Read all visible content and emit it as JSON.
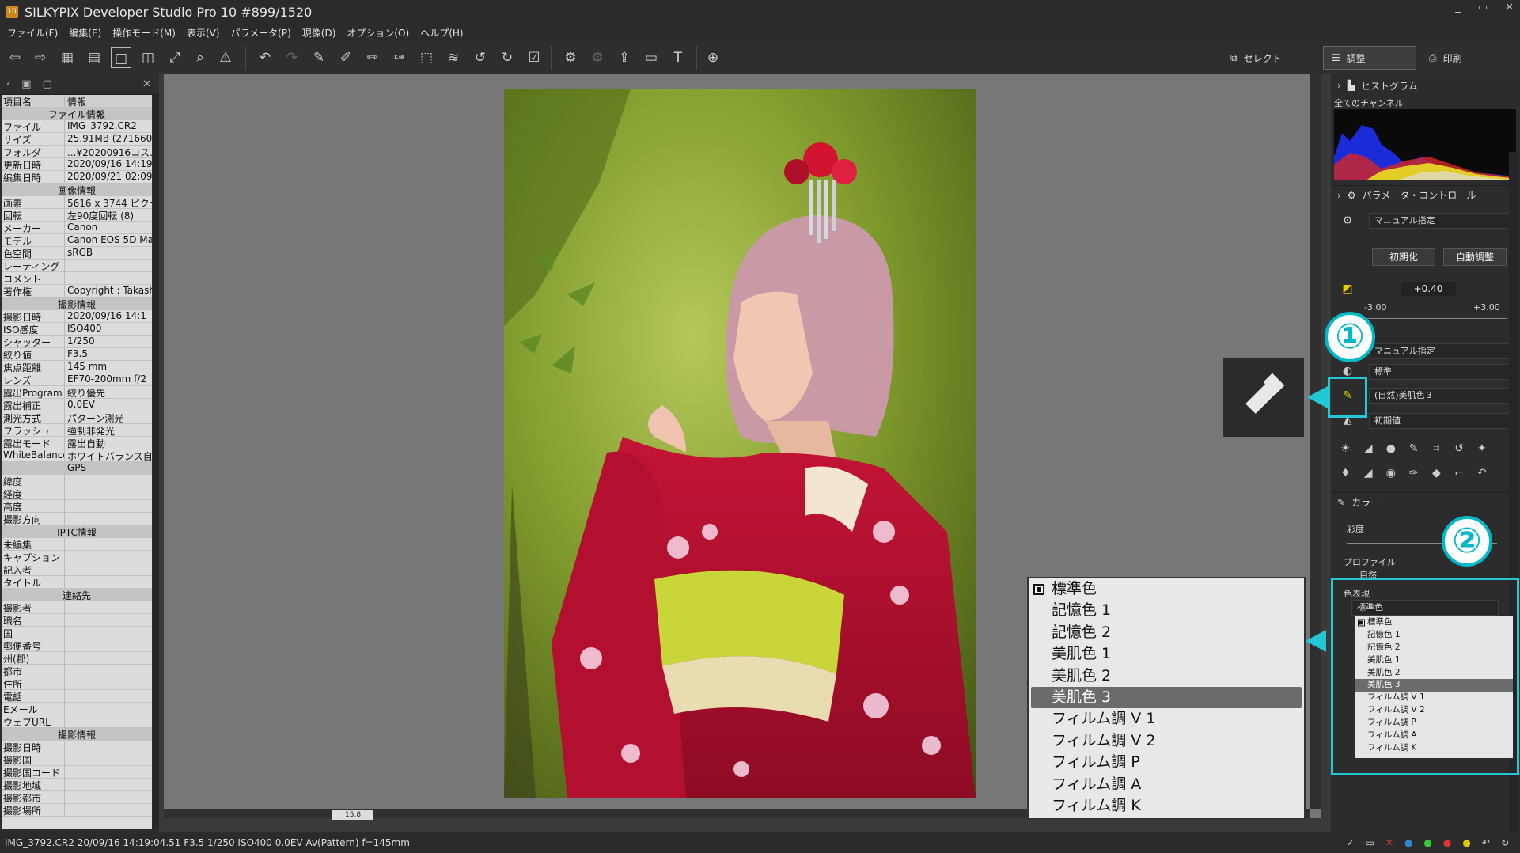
{
  "window": {
    "title": "SILKYPIX Developer Studio Pro 10   #899/1520",
    "app_icon": "10",
    "controls": [
      "_",
      "▭",
      "✕"
    ]
  },
  "menu": [
    "ファイル(F)",
    "編集(E)",
    "操作モード(M)",
    "表示(V)",
    "パラメータ(P)",
    "現像(D)",
    "オプション(O)",
    "ヘルプ(H)"
  ],
  "modes": {
    "select": "セレクト",
    "adjust": "調整",
    "print": "印刷"
  },
  "info_panel": {
    "col_item": "項目名",
    "col_info": "情報",
    "rows": [
      {
        "s": "ファイル情報"
      },
      {
        "k": "ファイル",
        "v": "IMG_3792.CR2"
      },
      {
        "k": "サイズ",
        "v": "25.91MB (2716606"
      },
      {
        "k": "フォルダ",
        "v": "...¥20200916コス..."
      },
      {
        "k": "更新日時",
        "v": "2020/09/16 14:19:"
      },
      {
        "k": "編集日時",
        "v": "2020/09/21 02:09:"
      },
      {
        "s": "画像情報"
      },
      {
        "k": "画素",
        "v": "5616 x 3744 ピクセ/"
      },
      {
        "k": "回転",
        "v": "左90度回転 (8)"
      },
      {
        "k": "メーカー",
        "v": "Canon"
      },
      {
        "k": "モデル",
        "v": "Canon EOS 5D Ma"
      },
      {
        "k": "色空間",
        "v": "sRGB"
      },
      {
        "k": "レーティング",
        "v": ""
      },
      {
        "k": "コメント",
        "v": ""
      },
      {
        "k": "著作権",
        "v": "Copyright : Takash"
      },
      {
        "s": "撮影情報"
      },
      {
        "k": "撮影日時",
        "v": "2020/09/16 14:1"
      },
      {
        "k": "ISO感度",
        "v": "ISO400"
      },
      {
        "k": "シャッター",
        "v": "1/250"
      },
      {
        "k": "絞り値",
        "v": "F3.5"
      },
      {
        "k": "焦点距離",
        "v": "145 mm"
      },
      {
        "k": "レンズ",
        "v": "EF70-200mm f/2"
      },
      {
        "k": "露出Program",
        "v": "絞り優先"
      },
      {
        "k": "露出補正",
        "v": "0.0EV"
      },
      {
        "k": "測光方式",
        "v": "パターン測光"
      },
      {
        "k": "フラッシュ",
        "v": "強制非発光"
      },
      {
        "k": "露出モード",
        "v": "露出自動"
      },
      {
        "k": "WhiteBalance",
        "v": "ホワイトバランス自動"
      },
      {
        "s": "GPS"
      },
      {
        "k": "緯度",
        "v": ""
      },
      {
        "k": "経度",
        "v": ""
      },
      {
        "k": "高度",
        "v": ""
      },
      {
        "k": "撮影方向",
        "v": ""
      },
      {
        "s": "IPTC情報"
      },
      {
        "k": "未編集",
        "v": ""
      },
      {
        "k": "キャプション",
        "v": ""
      },
      {
        "k": "記入者",
        "v": ""
      },
      {
        "k": "タイトル",
        "v": ""
      },
      {
        "s": "連絡先"
      },
      {
        "k": "撮影者",
        "v": ""
      },
      {
        "k": "職名",
        "v": ""
      },
      {
        "k": "国",
        "v": ""
      },
      {
        "k": "郵便番号",
        "v": ""
      },
      {
        "k": "州(郡)",
        "v": ""
      },
      {
        "k": "都市",
        "v": ""
      },
      {
        "k": "住所",
        "v": ""
      },
      {
        "k": "電話",
        "v": ""
      },
      {
        "k": "Eメール",
        "v": ""
      },
      {
        "k": "ウェブURL",
        "v": ""
      },
      {
        "s": "撮影情報"
      },
      {
        "k": "撮影日時",
        "v": ""
      },
      {
        "k": "撮影国",
        "v": ""
      },
      {
        "k": "撮影国コード",
        "v": ""
      },
      {
        "k": "撮影地域",
        "v": ""
      },
      {
        "k": "撮影都市",
        "v": ""
      },
      {
        "k": "撮影場所",
        "v": ""
      }
    ]
  },
  "viewer": {
    "zoom": "15.8",
    "zoom_unit": "%"
  },
  "right_panel": {
    "histogram": {
      "title": "ヒストグラム",
      "channel": "全てのチャンネル"
    },
    "param": {
      "title": "パラメータ・コントロール",
      "taste": "マニュアル指定",
      "init_btn": "初期化",
      "auto_btn": "自動調整",
      "exposure": "+0.40",
      "exp_min": "-3.00",
      "exp_max": "+3.00",
      "wb": "マニュアル指定",
      "tone": "標準",
      "color": "(自然)美肌色３",
      "sharp": "初期値"
    },
    "color_panel": {
      "title": "カラー",
      "saturation": "彩度",
      "profile": "プロファイル",
      "profile_val": "自然",
      "color_expr": "色表現",
      "color_expr_val": "標準色"
    },
    "small_list": [
      "標準色",
      "記憶色 1",
      "記憶色 2",
      "美肌色 1",
      "美肌色 2",
      "美肌色 3",
      "フィルム調 V 1",
      "フィルム調 V 2",
      "フィルム調 P",
      "フィルム調 A",
      "フィルム調 K"
    ],
    "small_selected": 5
  },
  "callouts": {
    "one": "①",
    "two": "②"
  },
  "big_list": [
    "標準色",
    "記憶色 1",
    "記憶色 2",
    "美肌色 1",
    "美肌色 2",
    "美肌色 3",
    "フィルム調 V 1",
    "フィルム調 V 2",
    "フィルム調 P",
    "フィルム調 A",
    "フィルム調 K"
  ],
  "big_selected": 5,
  "status": "IMG_3792.CR2 20/09/16 14:19:04.51 F3.5 1/250 ISO400  0.0EV Av(Pattern) f=145mm",
  "colors": {
    "accent": "#22c8d4",
    "panel": "#2c2c2c",
    "viewer_bg": "#777777"
  }
}
